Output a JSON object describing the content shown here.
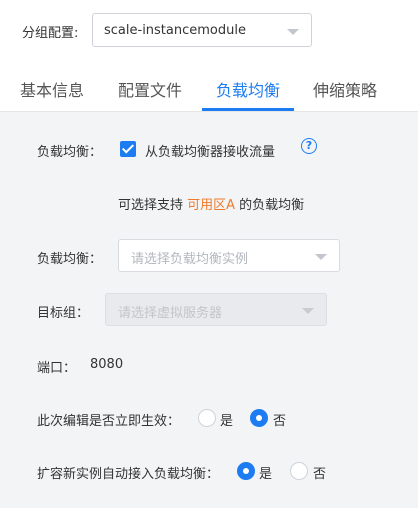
{
  "header": {
    "group_label": "分组配置:",
    "group_value": "scale-instancemodule"
  },
  "tabs": [
    {
      "label": "基本信息",
      "active": false
    },
    {
      "label": "配置文件",
      "active": false
    },
    {
      "label": "负载均衡",
      "active": true
    },
    {
      "label": "伸缩策略",
      "active": false
    }
  ],
  "form": {
    "lb_label": "负载均衡：",
    "receive_traffic_label": "从负载均衡器接收流量",
    "receive_traffic_checked": true,
    "help_icon": "?",
    "hint_prefix": "可选择支持 ",
    "hint_zone": "可用区A",
    "hint_suffix": " 的负载均衡",
    "lb_select_label": "负载均衡：",
    "lb_select_placeholder": "请选择负载均衡实例",
    "target_group_label": "目标组：",
    "target_group_placeholder": "请选择虚拟服务器",
    "port_label": "端口：",
    "port_value": "8080",
    "apply_now_label": "此次编辑是否立即生效：",
    "apply_now_options": [
      {
        "label": "是",
        "selected": false
      },
      {
        "label": "否",
        "selected": true
      }
    ],
    "auto_attach_label": "扩容新实例自动接入负载均衡：",
    "auto_attach_options": [
      {
        "label": "是",
        "selected": true
      },
      {
        "label": "否",
        "selected": false
      }
    ]
  },
  "colors": {
    "accent": "#1d7cf2",
    "zone": "#f07a2a",
    "panel": "#f3f4f6"
  }
}
